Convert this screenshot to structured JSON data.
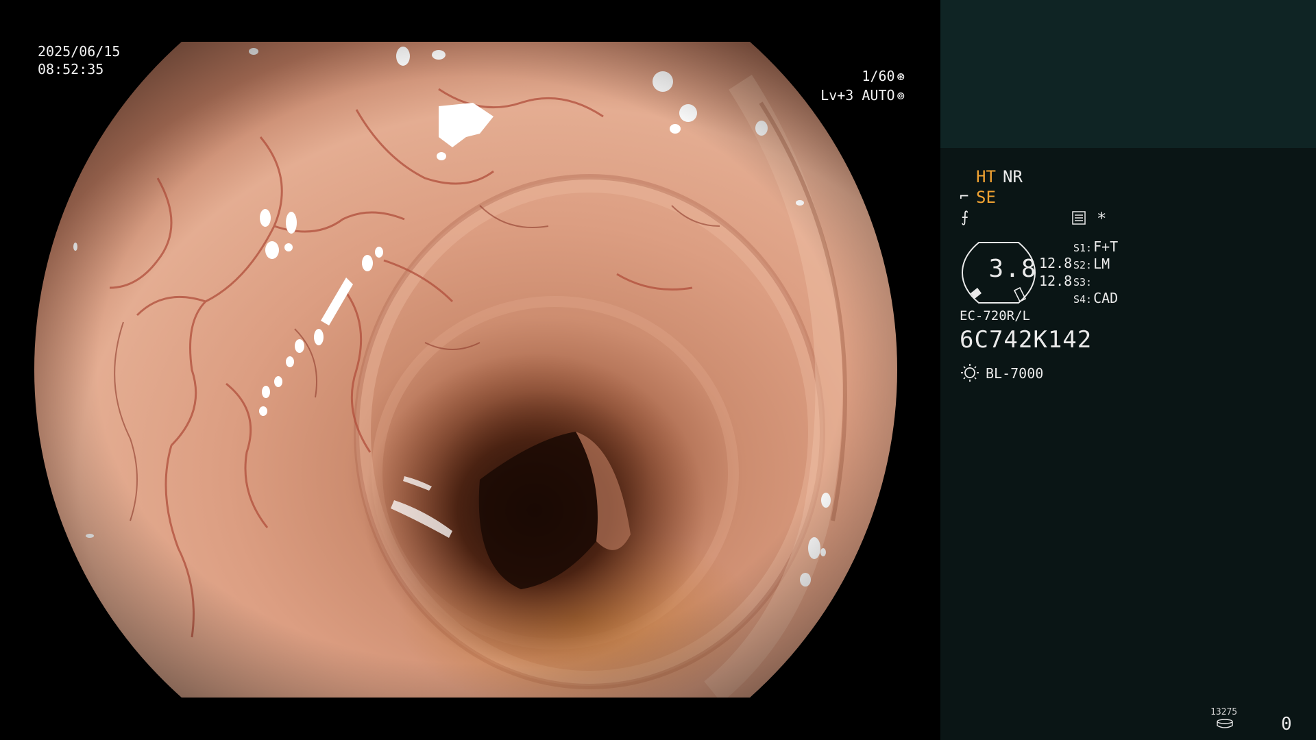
{
  "overlay": {
    "date": "2025/06/15",
    "time": "08:52:35",
    "shutter": "1/60",
    "shutter_icon": "shutter-icon",
    "exposure": "Lv+3 AUTO",
    "exposure_icon": "iris-icon"
  },
  "panel": {
    "ht": "HT",
    "nr": "NR",
    "se_icon": "enhance-curve-icon",
    "se": "SE",
    "f_icon": "frequency-icon",
    "menu_icon": "menu-icon",
    "star": "*",
    "dial_value": "3.8",
    "value_upper": "12.8",
    "value_lower": "12.8",
    "switches": [
      {
        "key": "S1:",
        "value": "F+T"
      },
      {
        "key": "S2:",
        "value": "LM"
      },
      {
        "key": "S3:",
        "value": ""
      },
      {
        "key": "S4:",
        "value": "CAD"
      }
    ],
    "scope_model": "EC-720R/L",
    "serial": "6C742K142",
    "light_icon": "light-source-icon",
    "light_source": "BL-7000",
    "counter_small": "13275",
    "disk_icon": "disk-icon",
    "counter_big": "0"
  },
  "colors": {
    "panel_bg": "#0a1515",
    "thumbnail_bg": "#0f2424",
    "amber": "#f0a232",
    "text": "#eaeaea"
  }
}
